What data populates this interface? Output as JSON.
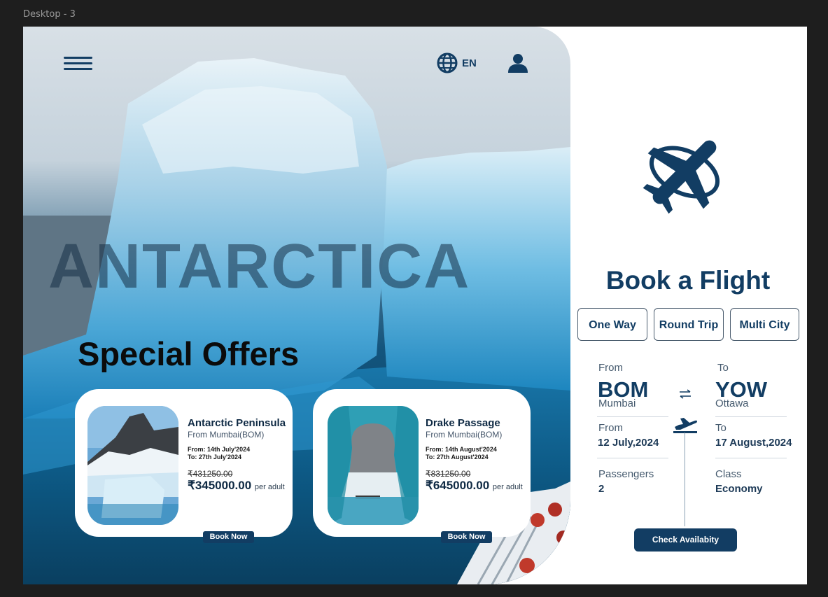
{
  "canvas": {
    "frame_label": "Desktop - 3"
  },
  "header": {
    "language": "EN"
  },
  "hero": {
    "destination": "ANTARCTICA",
    "section_title": "Special Offers"
  },
  "offers": [
    {
      "title": "Antarctic Peninsula",
      "origin": "From Mumbai(BOM)",
      "from_date": "From: 14th July'2024",
      "to_date": "To: 27th July'2024",
      "old_price": "₹431250.00",
      "price": "₹345000.00",
      "per_unit": "per adult",
      "button": "Book Now"
    },
    {
      "title": "Drake Passage",
      "origin": "From Mumbai(BOM)",
      "from_date": "From: 14th August'2024",
      "to_date": "To: 27th August'2024",
      "old_price": "₹831250.00",
      "price": "₹645000.00",
      "per_unit": "per adult",
      "button": "Book Now"
    }
  ],
  "booking": {
    "title": "Book a Flight",
    "trip_types": [
      "One Way",
      "Round Trip",
      "Multi City"
    ],
    "from_label": "From",
    "from_code": "BOM",
    "from_city": "Mumbai",
    "to_label": "To",
    "to_code": "YOW",
    "to_city": "Ottawa",
    "depart_label": "From",
    "depart_date": "12 July,2024",
    "return_label": "To",
    "return_date": "17 August,2024",
    "passengers_label": "Passengers",
    "passengers": "2",
    "class_label": "Class",
    "class_value": "Economy",
    "submit": "Check Availabity"
  },
  "colors": {
    "primary": "#123d63",
    "background": "#1e1e1e",
    "surface": "#ffffff"
  },
  "icons": [
    "menu-icon",
    "globe-icon",
    "user-icon",
    "airplane-logo-icon",
    "swap-icon",
    "departure-icon"
  ]
}
